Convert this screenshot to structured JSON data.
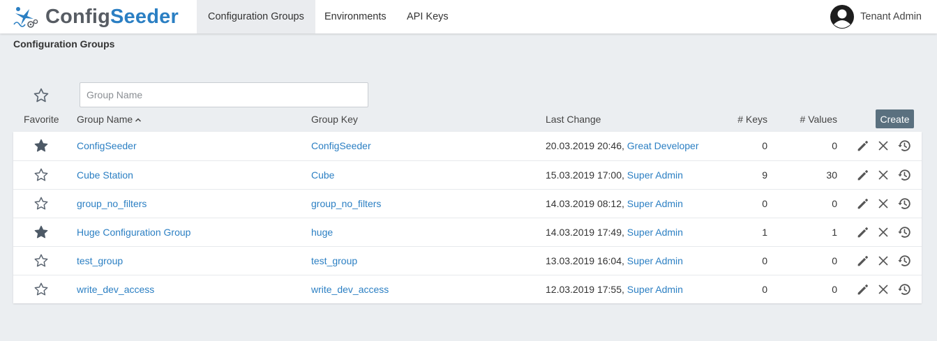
{
  "app": {
    "brand_part1": "Config",
    "brand_part2": "Seeder",
    "brand_color": "#2b7fc3",
    "logo_icon": "configseeder-logo-icon"
  },
  "nav": {
    "tabs": [
      {
        "label": "Configuration Groups",
        "active": true
      },
      {
        "label": "Environments",
        "active": false
      },
      {
        "label": "API Keys",
        "active": false
      }
    ]
  },
  "user": {
    "name": "Tenant Admin",
    "icon": "user-avatar-icon"
  },
  "page": {
    "title": "Configuration Groups"
  },
  "filters": {
    "favorite_icon": "star-outline-icon",
    "group_name_placeholder": "Group Name"
  },
  "table": {
    "headers": {
      "favorite": "Favorite",
      "group_name": "Group Name",
      "group_key": "Group Key",
      "last_change": "Last Change",
      "keys": "# Keys",
      "values": "# Values"
    },
    "sort": {
      "column": "group_name",
      "direction": "ascending"
    },
    "create_label": "Create",
    "create_color": "#5a707f",
    "rows": [
      {
        "favorite": true,
        "name": "ConfigSeeder",
        "key": "ConfigSeeder",
        "date": "20.03.2019 20:46,",
        "user": "Great Developer",
        "keys": "0",
        "values": "0"
      },
      {
        "favorite": false,
        "name": "Cube Station",
        "key": "Cube",
        "date": "15.03.2019 17:00,",
        "user": "Super Admin",
        "keys": "9",
        "values": "30"
      },
      {
        "favorite": false,
        "name": "group_no_filters",
        "key": "group_no_filters",
        "date": "14.03.2019 08:12,",
        "user": "Super Admin",
        "keys": "0",
        "values": "0"
      },
      {
        "favorite": true,
        "name": "Huge Configuration Group",
        "key": "huge",
        "date": "14.03.2019 17:49,",
        "user": "Super Admin",
        "keys": "1",
        "values": "1"
      },
      {
        "favorite": false,
        "name": "test_group",
        "key": "test_group",
        "date": "13.03.2019 16:04,",
        "user": "Super Admin",
        "keys": "0",
        "values": "0"
      },
      {
        "favorite": false,
        "name": "write_dev_access",
        "key": "write_dev_access",
        "date": "12.03.2019 17:55,",
        "user": "Super Admin",
        "keys": "0",
        "values": "0"
      }
    ],
    "row_actions": [
      "edit-pencil-icon",
      "delete-x-icon",
      "history-icon"
    ]
  }
}
